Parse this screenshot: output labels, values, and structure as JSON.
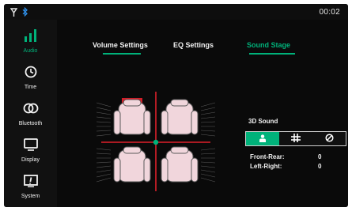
{
  "status_bar": {
    "time": "00:02",
    "icons": [
      "signal-icon",
      "bluetooth-icon"
    ]
  },
  "sidebar": {
    "items": [
      {
        "label": "Audio",
        "icon": "equalizer-bars-icon",
        "active": true
      },
      {
        "label": "Time",
        "icon": "clock-icon",
        "active": false
      },
      {
        "label": "Bluetooth",
        "icon": "bluetooth-link-icon",
        "active": false
      },
      {
        "label": "Display",
        "icon": "display-icon",
        "active": false
      },
      {
        "label": "System",
        "icon": "system-info-icon",
        "active": false
      }
    ]
  },
  "tabs": [
    {
      "label": "Volume Settings",
      "active": false
    },
    {
      "label": "EQ Settings",
      "active": false
    },
    {
      "label": "Sound Stage",
      "active": true
    }
  ],
  "sound_stage": {
    "title": "3D Sound",
    "modes": [
      {
        "icon": "driver-seat-icon",
        "active": true
      },
      {
        "icon": "all-seats-icon",
        "active": false
      },
      {
        "icon": "off-icon",
        "active": false
      }
    ],
    "front_rear_label": "Front-Rear:",
    "front_rear_value": "0",
    "left_right_label": "Left-Right:",
    "left_right_value": "0"
  },
  "colors": {
    "accent": "#00b27a",
    "crosshair": "#e0202a",
    "seat_fill": "#f1d6dc",
    "background": "#0a0a0a"
  }
}
